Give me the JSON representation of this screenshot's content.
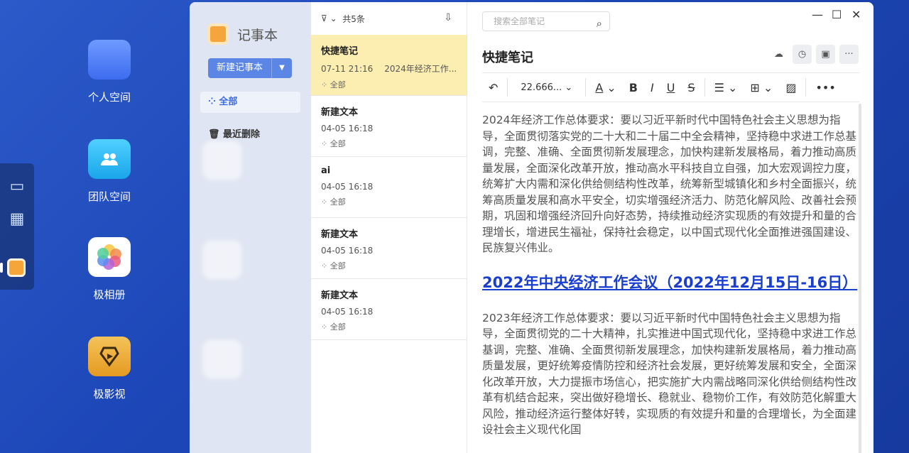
{
  "desktop": {
    "icons": [
      {
        "label": "个人空间",
        "icon": "folder-icon"
      },
      {
        "label": "团队空间",
        "icon": "team-folder-icon"
      },
      {
        "label": "极相册",
        "icon": "photos-icon"
      },
      {
        "label": "极影视",
        "icon": "video-icon"
      }
    ]
  },
  "app": {
    "title": "记事本",
    "new_notebook": "新建记事本",
    "nav_all": "全部",
    "nav_trash": "最近删除"
  },
  "list": {
    "count": "共5条",
    "notes": [
      {
        "title": "快捷笔记",
        "time": "07-11 21:16",
        "snippet": "2024年经济工作...",
        "folder": "全部"
      },
      {
        "title": "新建文本",
        "time": "04-05 16:18",
        "snippet": "",
        "folder": "全部"
      },
      {
        "title": "ai",
        "time": "04-05 16:18",
        "snippet": "",
        "folder": "全部"
      },
      {
        "title": "新建文本",
        "time": "04-05 16:18",
        "snippet": "",
        "folder": "全部"
      },
      {
        "title": "新建文本",
        "time": "04-05 16:18",
        "snippet": "",
        "folder": "全部"
      }
    ]
  },
  "editor": {
    "search_placeholder": "搜索全部笔记",
    "title": "快捷笔记",
    "font_size": "22.666...",
    "para1": "2024年经济工作总体要求：要以习近平新时代中国特色社会主义思想为指导，全面贯彻落实党的二十大和二十届二中全会精神，坚持稳中求进工作总基调，完整、准确、全面贯彻新发展理念，加快构建新发展格局，着力推动高质量发展，全面深化改革开放，推动高水平科技自立自强，加大宏观调控力度，统筹扩大内需和深化供给侧结构性改革，统筹新型城镇化和乡村全面振兴，统筹高质量发展和高水平安全，切实增强经济活力、防范化解风险、改善社会预期，巩固和增强经济回升向好态势，持续推动经济实现质的有效提升和量的合理增长，增进民生福祉，保持社会稳定，以中国式现代化全面推进强国建设、民族复兴伟业。",
    "heading": "2022年中央经济工作会议（2022年12月15日-16日）",
    "para2": "2023年经济工作总体要求：要以习近平新时代中国特色社会主义思想为指导，全面贯彻党的二十大精神，扎实推进中国式现代化，坚持稳中求进工作总基调，完整、准确、全面贯彻新发展理念，加快构建新发展格局，着力推动高质量发展，更好统筹疫情防控和经济社会发展，更好统筹发展和安全，全面深化改革开放，大力提振市场信心，把实施扩大内需战略同深化供给侧结构性改革有机结合起来，突出做好稳增长、稳就业、稳物价工作，有效防范化解重大风险，推动经济运行整体好转，实现质的有效提升和量的合理增长，为全面建设社会主义现代化国"
  }
}
